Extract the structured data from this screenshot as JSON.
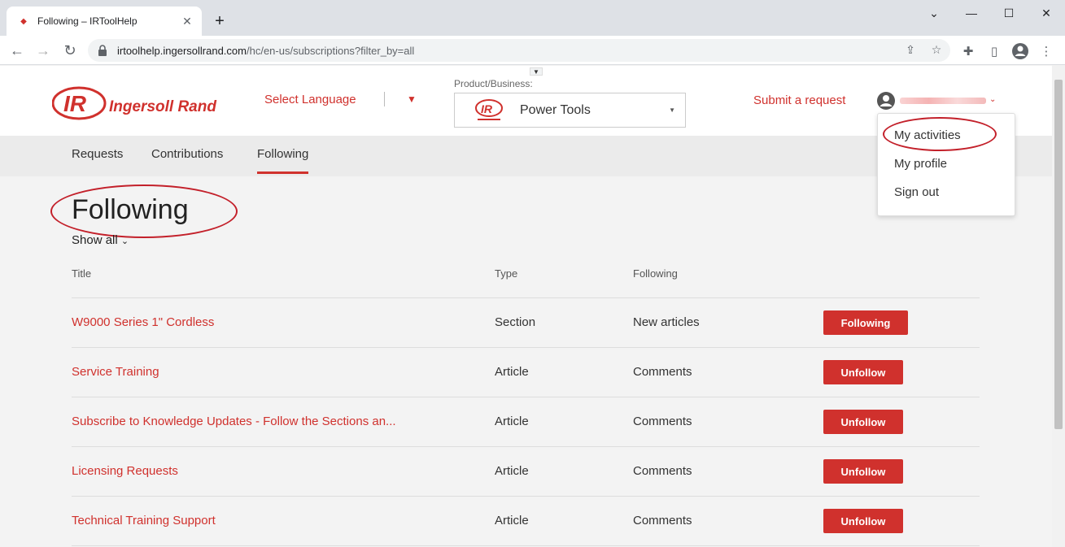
{
  "browser": {
    "tab_title": "Following – IRToolHelp",
    "url_domain": "irtoolhelp.ingersollrand.com",
    "url_path": "/hc/en-us/subscriptions?filter_by=all"
  },
  "header": {
    "select_language": "Select Language",
    "product_label": "Product/Business:",
    "product_value": "Power Tools",
    "submit_request": "Submit a request"
  },
  "user_menu": {
    "items": [
      "My activities",
      "My profile",
      "Sign out"
    ]
  },
  "subnav": {
    "items": [
      "Requests",
      "Contributions",
      "Following"
    ]
  },
  "main": {
    "title": "Following",
    "filter": "Show all"
  },
  "table": {
    "headers": [
      "Title",
      "Type",
      "Following"
    ],
    "rows": [
      {
        "title": "W9000 Series 1\" Cordless",
        "type": "Section",
        "following": "New articles",
        "action": "Following"
      },
      {
        "title": "Service Training",
        "type": "Article",
        "following": "Comments",
        "action": "Unfollow"
      },
      {
        "title": "Subscribe to Knowledge Updates - Follow the Sections an...",
        "type": "Article",
        "following": "Comments",
        "action": "Unfollow"
      },
      {
        "title": "Licensing Requests",
        "type": "Article",
        "following": "Comments",
        "action": "Unfollow"
      },
      {
        "title": "Technical Training Support",
        "type": "Article",
        "following": "Comments",
        "action": "Unfollow"
      }
    ]
  },
  "brand": {
    "name": "Ingersoll Rand",
    "accent": "#d0312d"
  }
}
